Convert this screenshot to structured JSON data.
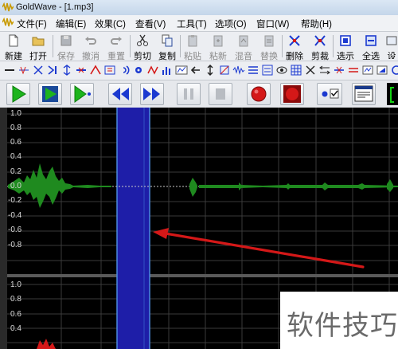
{
  "window": {
    "title": "GoldWave - [1.mp3]"
  },
  "menu": [
    "文件(F)",
    "编辑(E)",
    "效果(C)",
    "查看(V)",
    "工具(T)",
    "选项(O)",
    "窗口(W)",
    "帮助(H)"
  ],
  "toolbar": {
    "new": "新建",
    "open": "打开",
    "save": "保存",
    "undo": "撤消",
    "redo": "重置",
    "cut": "剪切",
    "copy": "复制",
    "paste": "粘贴",
    "paste_new": "粘新",
    "mix": "混音",
    "replace": "替换",
    "delete": "删除",
    "trim": "剪裁",
    "select": "选示",
    "select_all": "全选",
    "settings": "设"
  },
  "waveform": {
    "top_channel_ticks": [
      "1.0",
      "0.8",
      "0.6",
      "0.4",
      "0.2",
      "0.0",
      "-0.2",
      "-0.4",
      "-0.6",
      "-0.8"
    ],
    "bottom_channel_ticks": [
      "1.0",
      "0.8",
      "0.6",
      "0.4"
    ],
    "wave_color": "#1f8a1f",
    "selection_color": "#1e1ea8"
  },
  "watermark": "软件技巧",
  "colors": {
    "accent_red": "#d41818",
    "play_green": "#1db41d",
    "rewind_blue": "#1c3ad0"
  }
}
